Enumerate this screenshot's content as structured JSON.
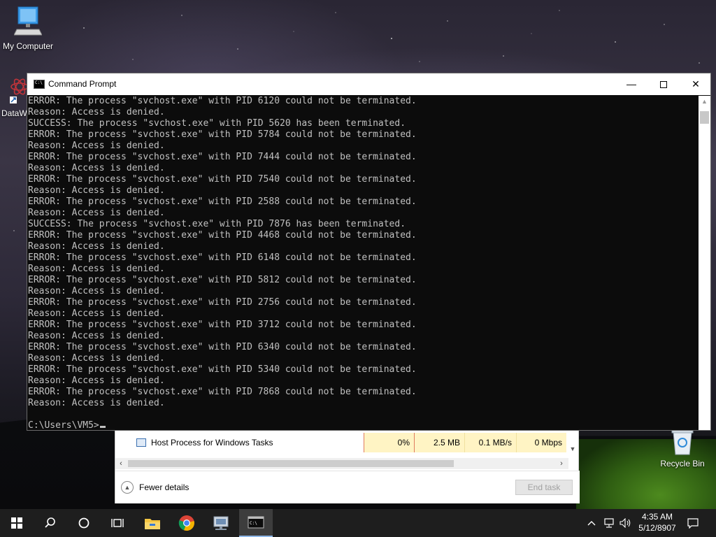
{
  "desktop": {
    "icons": [
      {
        "label": "My Computer",
        "icon": "computer-icon"
      },
      {
        "label": "DataW",
        "icon": "dataw-shortcut-icon"
      },
      {
        "label": "Recycle Bin",
        "icon": "recycle-bin-icon"
      }
    ]
  },
  "taskmgr": {
    "row": {
      "name": "Host Process for Windows Tasks",
      "cpu": "0%",
      "memory": "2.5 MB",
      "disk": "0.1 MB/s",
      "network": "0 Mbps"
    },
    "fewer_details": "Fewer details",
    "end_task": "End task"
  },
  "cmd": {
    "title": "Command Prompt",
    "lines": [
      "ERROR: The process \"svchost.exe\" with PID 6120 could not be terminated.",
      "Reason: Access is denied.",
      "SUCCESS: The process \"svchost.exe\" with PID 5620 has been terminated.",
      "ERROR: The process \"svchost.exe\" with PID 5784 could not be terminated.",
      "Reason: Access is denied.",
      "ERROR: The process \"svchost.exe\" with PID 7444 could not be terminated.",
      "Reason: Access is denied.",
      "ERROR: The process \"svchost.exe\" with PID 7540 could not be terminated.",
      "Reason: Access is denied.",
      "ERROR: The process \"svchost.exe\" with PID 2588 could not be terminated.",
      "Reason: Access is denied.",
      "SUCCESS: The process \"svchost.exe\" with PID 7876 has been terminated.",
      "ERROR: The process \"svchost.exe\" with PID 4468 could not be terminated.",
      "Reason: Access is denied.",
      "ERROR: The process \"svchost.exe\" with PID 6148 could not be terminated.",
      "Reason: Access is denied.",
      "ERROR: The process \"svchost.exe\" with PID 5812 could not be terminated.",
      "Reason: Access is denied.",
      "ERROR: The process \"svchost.exe\" with PID 2756 could not be terminated.",
      "Reason: Access is denied.",
      "ERROR: The process \"svchost.exe\" with PID 3712 could not be terminated.",
      "Reason: Access is denied.",
      "ERROR: The process \"svchost.exe\" with PID 6340 could not be terminated.",
      "Reason: Access is denied.",
      "ERROR: The process \"svchost.exe\" with PID 5340 could not be terminated.",
      "Reason: Access is denied.",
      "ERROR: The process \"svchost.exe\" with PID 7868 could not be terminated.",
      "Reason: Access is denied.",
      "",
      "C:\\Users\\VM5>"
    ]
  },
  "taskbar": {
    "buttons": [
      {
        "icon": "start-windows-icon"
      },
      {
        "icon": "search-icon"
      },
      {
        "icon": "cortana-circle-icon"
      },
      {
        "icon": "task-view-icon"
      },
      {
        "icon": "file-explorer-icon"
      },
      {
        "icon": "chrome-icon"
      },
      {
        "icon": "network-app-icon"
      },
      {
        "icon": "command-prompt-icon"
      }
    ],
    "time": "4:35 AM",
    "date": "5/12/8907"
  },
  "colors": {
    "console_bg": "#0c0c0c",
    "console_fg": "#c0c0c0",
    "taskbar_bg": "#1e1e1e",
    "highlight_cell": "#fff4c4"
  }
}
